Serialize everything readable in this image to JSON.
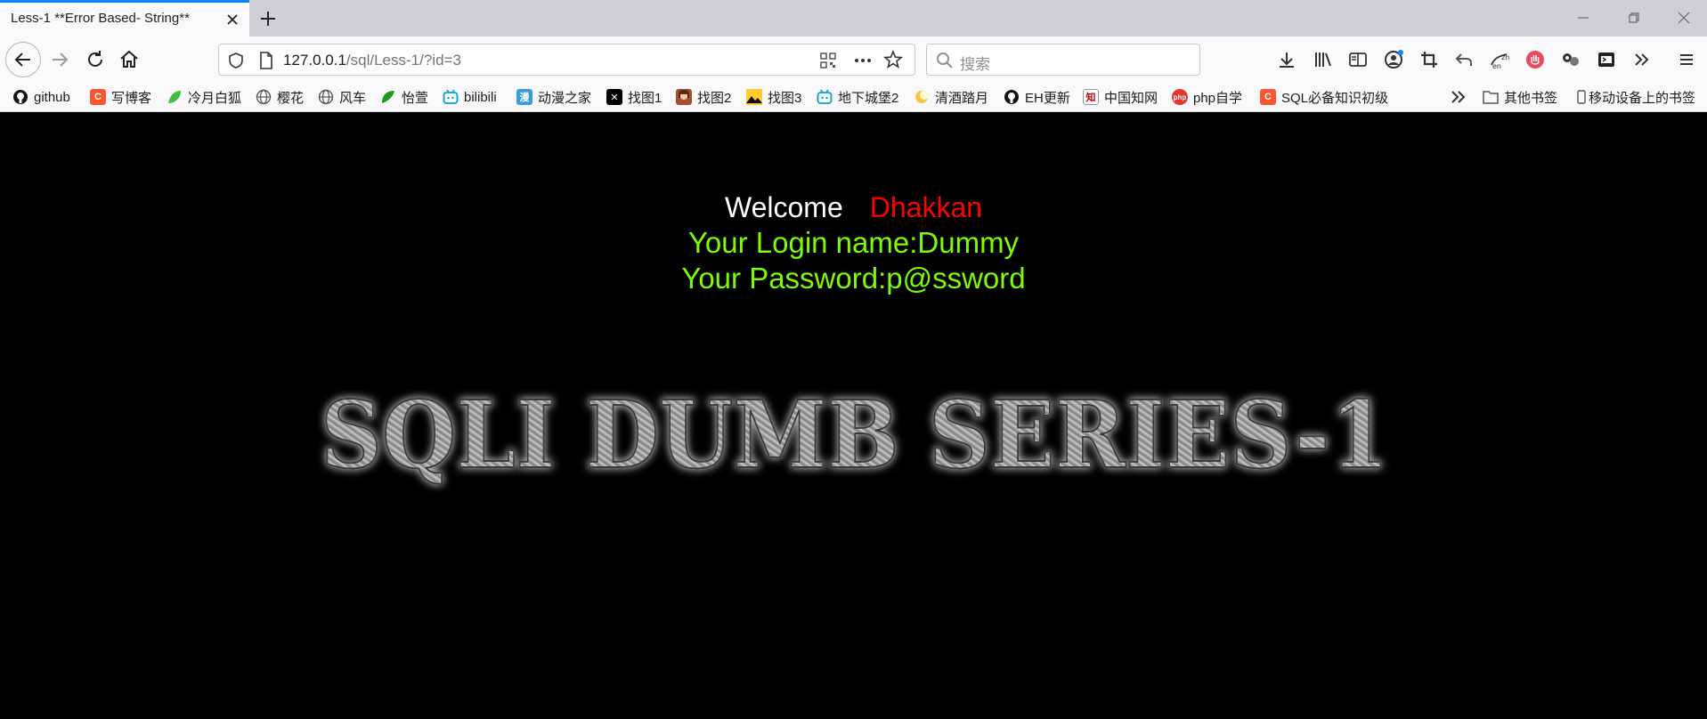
{
  "tab": {
    "title": "Less-1 **Error Based- String**"
  },
  "urlbar": {
    "host": "127.0.0.1",
    "path": "/sql/Less-1/?id=3"
  },
  "search": {
    "placeholder": "搜索"
  },
  "bookmarks": [
    {
      "label": "github",
      "icon": "github-icon",
      "color": "#000000"
    },
    {
      "label": "写博客",
      "icon": "csdn-icon",
      "color": "#fc5531"
    },
    {
      "label": "冷月白狐",
      "icon": "leaf-icon",
      "color": "#3fbf3f"
    },
    {
      "label": "樱花",
      "icon": "globe-icon",
      "color": "#555555"
    },
    {
      "label": "风车",
      "icon": "globe-icon",
      "color": "#555555"
    },
    {
      "label": "怡萱",
      "icon": "leaf-icon",
      "color": "#1a9a1a"
    },
    {
      "label": "bilibili",
      "icon": "bilibili-icon",
      "color": "#00a1d6"
    },
    {
      "label": "动漫之家",
      "icon": "manga-icon",
      "color": "#3b9be0"
    },
    {
      "label": "找图1",
      "icon": "x-icon",
      "color": "#000000"
    },
    {
      "label": "找图2",
      "icon": "avatar-icon",
      "color": "#a0522d"
    },
    {
      "label": "找图3",
      "icon": "image-icon",
      "color": "#f5a623"
    },
    {
      "label": "地下城堡2",
      "icon": "bilibili-icon",
      "color": "#00a1d6"
    },
    {
      "label": "清酒踏月",
      "icon": "moon-icon",
      "color": "#f5c542"
    },
    {
      "label": "EH更新",
      "icon": "github-icon",
      "color": "#000000"
    },
    {
      "label": "中国知网",
      "icon": "cnki-icon",
      "color": "#222222"
    },
    {
      "label": "php自学",
      "icon": "php-icon",
      "color": "#e8322f"
    },
    {
      "label": "SQL必备知识初级",
      "icon": "csdn-icon",
      "color": "#fc5531"
    }
  ],
  "bookmarks_right": [
    {
      "label": "其他书签",
      "icon": "folder-icon"
    },
    {
      "label": "移动设备上的书签",
      "icon": "mobile-icon"
    }
  ],
  "page": {
    "welcome": "Welcome",
    "user": "Dhakkan",
    "login_line": "Your Login name:Dummy",
    "password_line": "Your Password:p@ssword",
    "banner": "SQLI DUMB SERIES-1"
  },
  "colors": {
    "welcome": "#ffffff",
    "user": "#ff0000",
    "info": "#7cfc00",
    "background": "#000000",
    "tab_accent": "#0a84ff"
  }
}
